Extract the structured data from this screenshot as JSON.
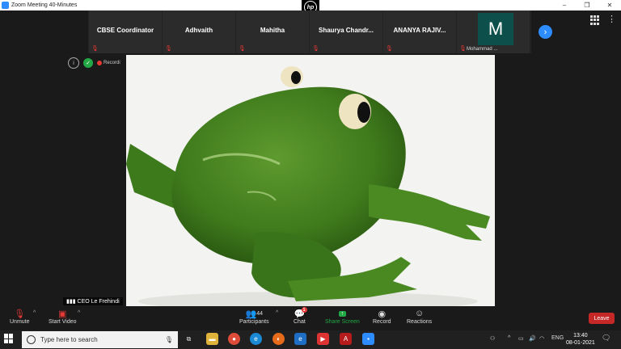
{
  "window": {
    "title": "Zoom Meeting 40-Minutes",
    "controls": [
      "–",
      "❐",
      "✕"
    ]
  },
  "hp_logo": "hp",
  "participants": [
    {
      "name": "CBSE Coordinator",
      "muted": true
    },
    {
      "name": "Adhvaith",
      "muted": true
    },
    {
      "name": "Mahitha",
      "muted": true
    },
    {
      "name": "Shaurya  Chandr...",
      "muted": true
    },
    {
      "name": "ANANYA RAJIV...",
      "muted": true
    },
    {
      "name": "Mohammad ...",
      "initial": "M",
      "muted": true
    }
  ],
  "next_page_icon": "›",
  "recording_label": "Recordi",
  "speaker_label": "CEO Le Frehindi",
  "toolbar": {
    "unmute": "Unmute",
    "start_video": "Start Video",
    "participants": "Participants",
    "participants_count": "44",
    "chat": "Chat",
    "chat_badge": "1",
    "share_screen": "Share Screen",
    "record": "Record",
    "reactions": "Reactions",
    "leave": "Leave"
  },
  "taskbar": {
    "search_placeholder": "Type here to search",
    "language": "ENG",
    "time": "13:40",
    "date": "08-01-2021"
  },
  "colors": {
    "zoom_blue": "#2D8CFF",
    "leave_red": "#C62828",
    "share_green": "#22A845"
  }
}
